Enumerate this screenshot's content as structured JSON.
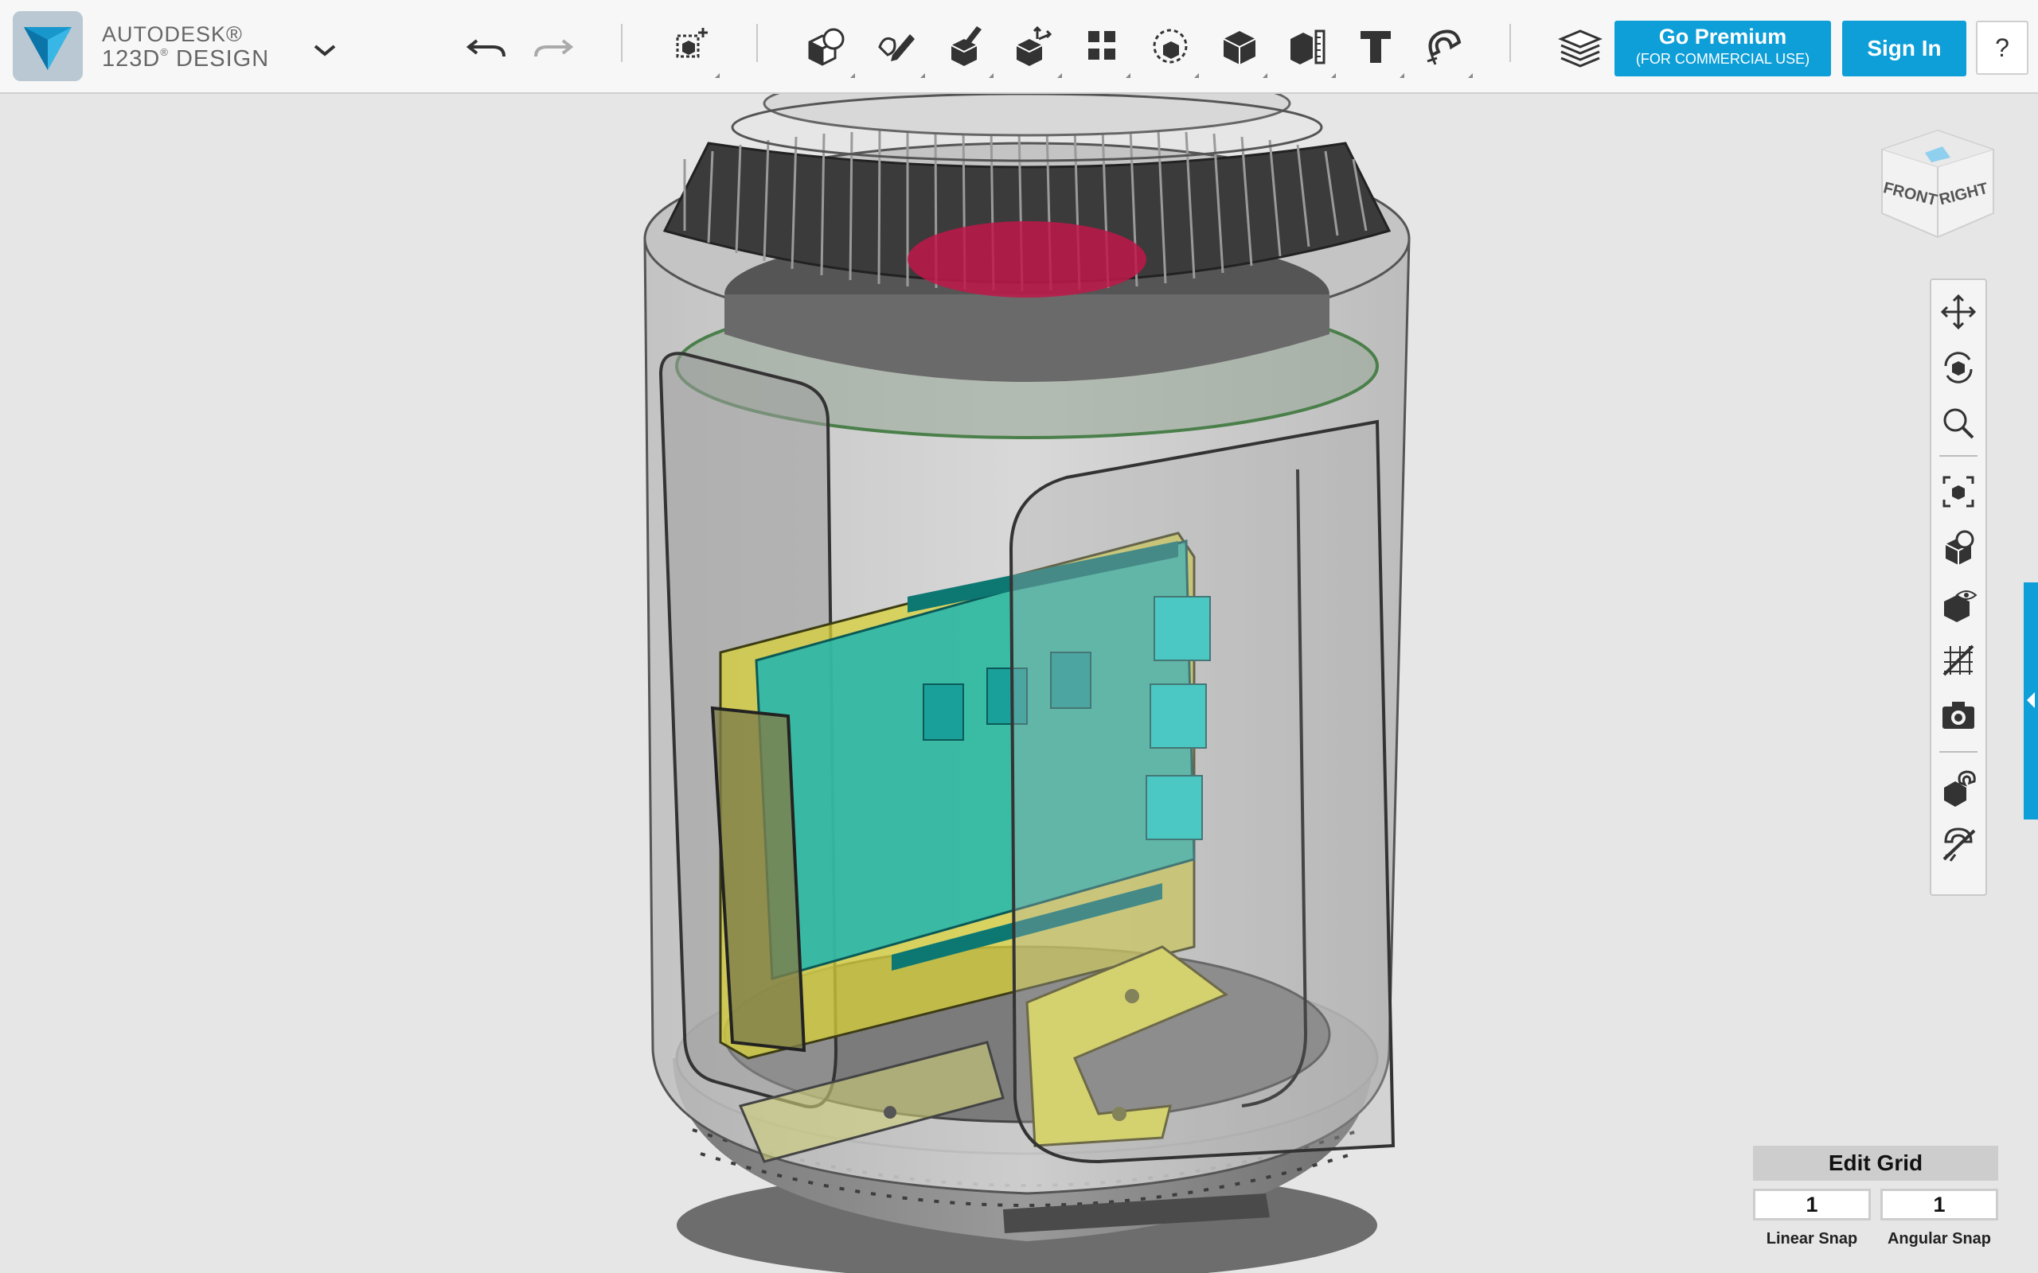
{
  "app": {
    "brand_line1": "AUTODESK®",
    "brand_line2": "123D",
    "brand_line2_suffix": " DESIGN",
    "accent_color": "#0e9fd8"
  },
  "toolbar": {
    "tools": [
      {
        "name": "undo-icon",
        "interactable": true
      },
      {
        "name": "redo-icon",
        "interactable": false
      },
      {
        "name": "transform-icon",
        "interactable": true
      },
      {
        "name": "primitives-icon",
        "interactable": true
      },
      {
        "name": "sketch-icon",
        "interactable": true
      },
      {
        "name": "construct-icon",
        "interactable": true
      },
      {
        "name": "modify-icon",
        "interactable": true
      },
      {
        "name": "pattern-icon",
        "interactable": true
      },
      {
        "name": "grouping-icon",
        "interactable": true
      },
      {
        "name": "combine-icon",
        "interactable": true
      },
      {
        "name": "measure-icon",
        "interactable": true
      },
      {
        "name": "text-icon",
        "interactable": true
      },
      {
        "name": "snap-icon",
        "interactable": true
      },
      {
        "name": "materials-icon",
        "interactable": true
      }
    ],
    "premium_line1": "Go Premium",
    "premium_line2": "(FOR COMMERCIAL USE)",
    "signin_label": "Sign In",
    "help_label": "?"
  },
  "viewcube": {
    "front_label": "FRONT",
    "right_label": "RIGHT"
  },
  "navbar": {
    "items": [
      "pan-icon",
      "orbit-icon",
      "zoom-icon",
      "fit-icon",
      "views-icon",
      "visibility-icon",
      "grid-toggle-icon",
      "screenshot-icon",
      "material-snap-icon",
      "hide-materials-icon"
    ]
  },
  "edit_grid": {
    "title": "Edit Grid",
    "linear_snap_value": "1",
    "angular_snap_value": "1",
    "linear_snap_label": "Linear Snap",
    "angular_snap_label": "Angular Snap"
  }
}
